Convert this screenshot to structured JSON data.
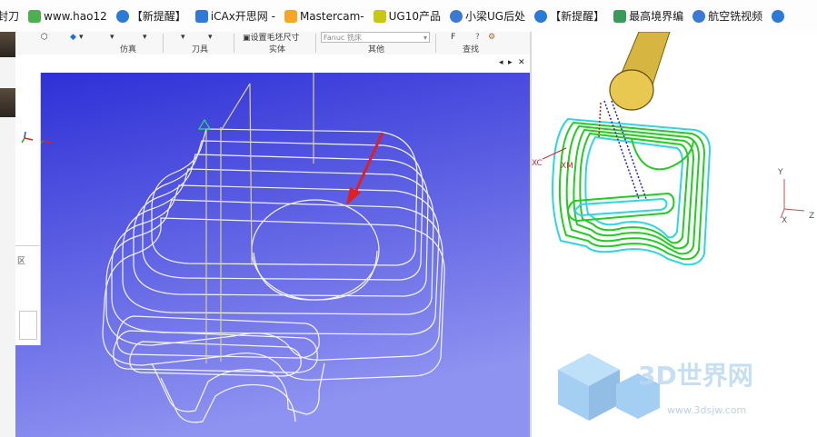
{
  "bookmarks": [
    {
      "label": "封刀",
      "icon": "none",
      "color": "#ffffff"
    },
    {
      "label": "www.hao12",
      "icon": "hao123-icon",
      "color": "#4caf50"
    },
    {
      "label": "【新提醒】",
      "icon": "forum-bird-icon",
      "color": "#2b7bd6"
    },
    {
      "label": "iCAx开思网 -",
      "icon": "icax-icon",
      "color": "#2f7ad8"
    },
    {
      "label": "Mastercam-",
      "icon": "mastercam-icon",
      "color": "#f5a623"
    },
    {
      "label": "UG10产品",
      "icon": "ug-shield-icon",
      "color": "#c8c810"
    },
    {
      "label": "小梁UG后处",
      "icon": "link-icon",
      "color": "#3a7ad5"
    },
    {
      "label": "【新提醒】",
      "icon": "forum-bird-icon",
      "color": "#2b7bd6"
    },
    {
      "label": "最高境界编",
      "icon": "hexagon-icon",
      "color": "#3a9a5a"
    },
    {
      "label": "航空铣视频",
      "icon": "link-icon",
      "color": "#3a7ad5"
    },
    {
      "label": "",
      "icon": "forum-bird-icon",
      "color": "#2b7bd6"
    }
  ],
  "ribbon": {
    "groups": [
      "仿真",
      "刀具",
      "实体",
      "其他",
      "查找"
    ],
    "set_blank_size": "设置毛坯尺寸",
    "machine_dropdown": "Fanuc 铣床",
    "find_label": "F"
  },
  "viewport_header": {
    "controls": [
      "◂",
      "▸",
      "✕"
    ]
  },
  "left_panel": {
    "mark": "区"
  },
  "viewport2": {
    "axis_labels": {
      "y": "Y",
      "x": "X",
      "z": "Z"
    },
    "xc_label": "XC",
    "xm_label": "XM"
  },
  "watermark": {
    "title": "3D世界网",
    "url": "www.3dsjw.com"
  },
  "colors": {
    "viewport_gradient_top": "#2d2fd6",
    "viewport_gradient_bottom": "#8e92f0",
    "toolpath_green": "#22cc22",
    "toolpath_cyan": "#2fd6e0",
    "tool_gold": "#d6b640",
    "arrow_red": "#e02020"
  }
}
